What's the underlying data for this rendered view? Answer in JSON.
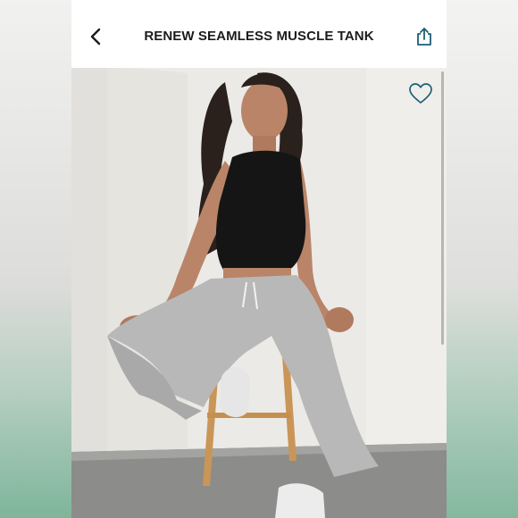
{
  "header": {
    "title": "RENEW SEAMLESS MUSCLE TANK",
    "back_icon": "chevron-left-icon",
    "share_icon": "share-icon"
  },
  "product_image": {
    "description_icon": "product-photo",
    "favorite_icon": "heart-outline-icon"
  },
  "colors": {
    "accent": "#1c5f73",
    "text": "#1c1c1c"
  }
}
